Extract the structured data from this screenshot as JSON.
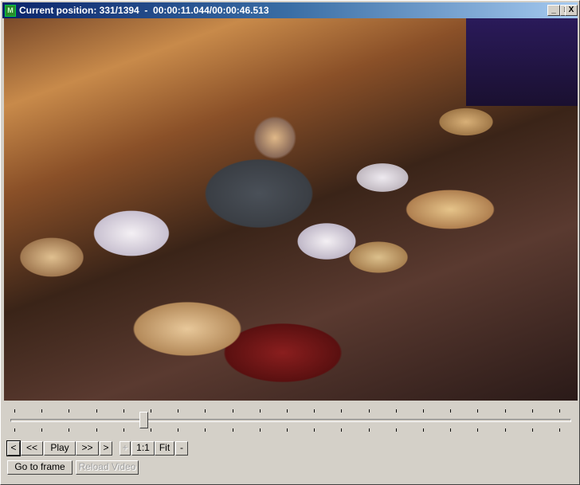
{
  "window": {
    "title": "Current position: 331/1394  -  00:00:11.044/00:00:46.513",
    "app_icon": "app-icon",
    "minimize": "_",
    "maximize": "□",
    "close": "X"
  },
  "position": {
    "current_frame": 331,
    "total_frames": 1394,
    "fraction": 0.237
  },
  "buttons": {
    "prev_frame": "<",
    "rewind": "<<",
    "play": "Play",
    "forward": ">>",
    "next_frame": ">",
    "zoom_in": "+",
    "zoom_1_1": "1:1",
    "fit": "Fit",
    "zoom_out": "-",
    "goto_frame": "Go to frame",
    "reload_video": "Reload Video"
  }
}
